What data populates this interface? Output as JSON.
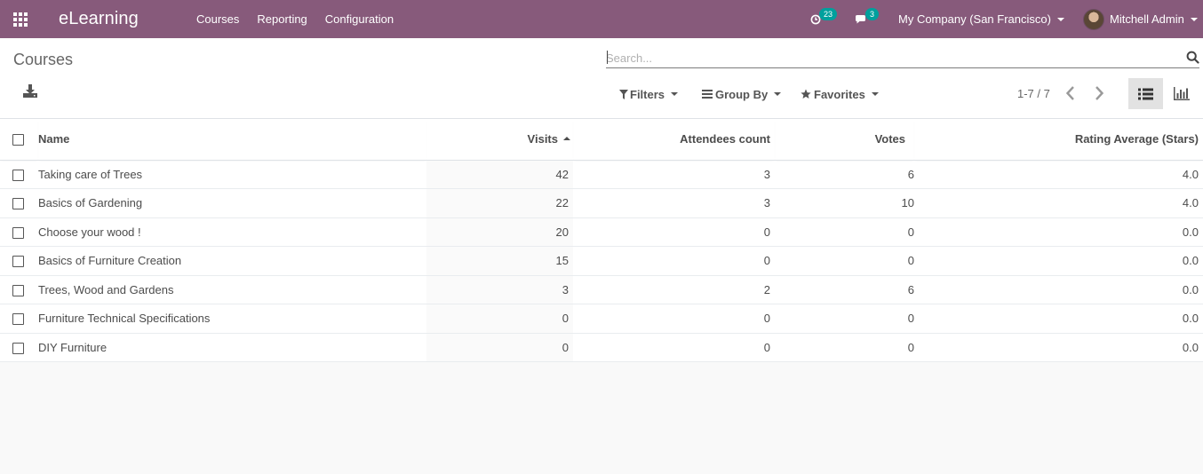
{
  "navbar": {
    "brand": "eLearning",
    "menu": [
      "Courses",
      "Reporting",
      "Configuration"
    ],
    "activity_count": "23",
    "message_count": "3",
    "company": "My Company (San Francisco)",
    "user": "Mitchell Admin",
    "bg_color": "#875a7b"
  },
  "control_panel": {
    "title": "Courses",
    "search_placeholder": "Search...",
    "filters_label": "Filters",
    "groupby_label": "Group By",
    "favorites_label": "Favorites",
    "pager": "1-7 / 7"
  },
  "table": {
    "columns": [
      "Name",
      "Visits",
      "Attendees count",
      "Votes",
      "Rating Average (Stars)"
    ],
    "sorted_column": "Visits",
    "rows": [
      {
        "name": "Taking care of Trees",
        "visits": "42",
        "attendees": "3",
        "votes": "6",
        "rating": "4.0"
      },
      {
        "name": "Basics of Gardening",
        "visits": "22",
        "attendees": "3",
        "votes": "10",
        "rating": "4.0"
      },
      {
        "name": "Choose your wood !",
        "visits": "20",
        "attendees": "0",
        "votes": "0",
        "rating": "0.0"
      },
      {
        "name": "Basics of Furniture Creation",
        "visits": "15",
        "attendees": "0",
        "votes": "0",
        "rating": "0.0"
      },
      {
        "name": "Trees, Wood and Gardens",
        "visits": "3",
        "attendees": "2",
        "votes": "6",
        "rating": "0.0"
      },
      {
        "name": "Furniture Technical Specifications",
        "visits": "0",
        "attendees": "0",
        "votes": "0",
        "rating": "0.0"
      },
      {
        "name": "DIY Furniture",
        "visits": "0",
        "attendees": "0",
        "votes": "0",
        "rating": "0.0"
      }
    ]
  },
  "icons": [
    "apps-icon",
    "activity-clock-icon",
    "chat-icon",
    "download-icon",
    "search-icon",
    "filter-icon",
    "group-by-icon",
    "star-icon",
    "chevron-left-icon",
    "chevron-right-icon",
    "list-view-icon",
    "graph-view-icon"
  ]
}
